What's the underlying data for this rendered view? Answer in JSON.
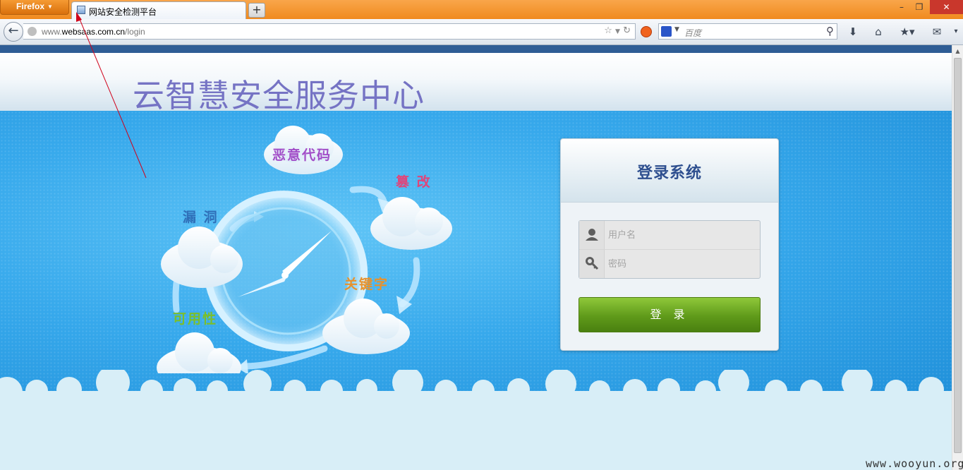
{
  "browser": {
    "app_button": "Firefox",
    "tab_title": "网站安全检测平台",
    "new_tab": "+",
    "window": {
      "minimize": "–",
      "maximize": "❐",
      "close": "✕"
    },
    "url_prefix": "www.",
    "url_domain": "websaas.com.cn",
    "url_path": "/login",
    "search_placeholder": "百度",
    "icons": [
      "back-arrow-icon",
      "globe-icon",
      "bookmark-star-icon",
      "reload-icon",
      "addon-icon",
      "baidu-icon",
      "search-icon",
      "download-icon",
      "home-icon",
      "bookmarks-icon",
      "extension-icon",
      "menu-chevron-icon"
    ]
  },
  "page": {
    "site_title": "云智慧安全服务中心",
    "clouds": {
      "malicious_code": "恶意代码",
      "tamper": "篡 改",
      "vulnerability": "漏 洞",
      "keyword": "关键字",
      "availability": "可用性"
    },
    "cloud_colors": {
      "malicious_code": "#a24ec8",
      "tamper": "#e0457a",
      "vulnerability": "#2f6fb8",
      "keyword": "#e8922c",
      "availability": "#7bbf2a"
    },
    "login": {
      "title": "登录系统",
      "username_placeholder": "用户名",
      "password_placeholder": "密码",
      "submit_label": "登 录"
    }
  },
  "watermark": "www.wooyun.org"
}
